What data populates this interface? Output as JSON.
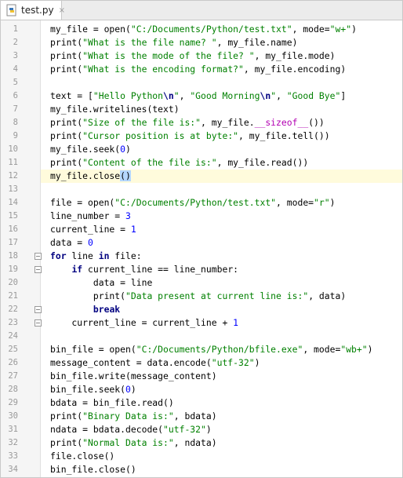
{
  "tab": {
    "label": "test.py",
    "close": "×"
  },
  "code": {
    "current_line": 12,
    "lines": [
      {
        "n": "1",
        "t": [
          [
            "my_file = open(",
            ""
          ],
          [
            "\"C:/Documents/Python/test.txt\"",
            "s"
          ],
          [
            ", mode=",
            ""
          ],
          [
            "\"w+\"",
            "s"
          ],
          [
            ")",
            ""
          ]
        ]
      },
      {
        "n": "2",
        "t": [
          [
            "print(",
            ""
          ],
          [
            "\"What is the file name? \"",
            "s"
          ],
          [
            ", my_file.name)",
            ""
          ]
        ]
      },
      {
        "n": "3",
        "t": [
          [
            "print(",
            ""
          ],
          [
            "\"What is the mode of the file? \"",
            "s"
          ],
          [
            ", my_file.mode)",
            ""
          ]
        ]
      },
      {
        "n": "4",
        "t": [
          [
            "print(",
            ""
          ],
          [
            "\"What is the encoding format?\"",
            "s"
          ],
          [
            ", my_file.encoding)",
            ""
          ]
        ]
      },
      {
        "n": "5",
        "t": []
      },
      {
        "n": "6",
        "t": [
          [
            "text = [",
            ""
          ],
          [
            "\"Hello Python",
            "s"
          ],
          [
            "\\n",
            "e"
          ],
          [
            "\"",
            "s"
          ],
          [
            ", ",
            ""
          ],
          [
            "\"Good Morning",
            "s"
          ],
          [
            "\\n",
            "e"
          ],
          [
            "\"",
            "s"
          ],
          [
            ", ",
            ""
          ],
          [
            "\"Good Bye\"",
            "s"
          ],
          [
            "]",
            ""
          ]
        ]
      },
      {
        "n": "7",
        "t": [
          [
            "my_file.writelines(text)",
            ""
          ]
        ]
      },
      {
        "n": "8",
        "t": [
          [
            "print(",
            ""
          ],
          [
            "\"Size of the file is:\"",
            "s"
          ],
          [
            ", my_file.",
            ""
          ],
          [
            "__sizeof__",
            "d"
          ],
          [
            "())",
            ""
          ]
        ]
      },
      {
        "n": "9",
        "t": [
          [
            "print(",
            ""
          ],
          [
            "\"Cursor position is at byte:\"",
            "s"
          ],
          [
            ", my_file.tell())",
            ""
          ]
        ]
      },
      {
        "n": "10",
        "t": [
          [
            "my_file.seek(",
            ""
          ],
          [
            "0",
            "n"
          ],
          [
            ")",
            ""
          ]
        ]
      },
      {
        "n": "11",
        "t": [
          [
            "print(",
            ""
          ],
          [
            "\"Content of the file is:\"",
            "s"
          ],
          [
            ", my_file.read())",
            ""
          ]
        ]
      },
      {
        "n": "12",
        "t": [
          [
            "my_file.close",
            ""
          ],
          [
            "()",
            "caret"
          ]
        ]
      },
      {
        "n": "13",
        "t": []
      },
      {
        "n": "14",
        "t": [
          [
            "file = open(",
            ""
          ],
          [
            "\"C:/Documents/Python/test.txt\"",
            "s"
          ],
          [
            ", mode=",
            ""
          ],
          [
            "\"r\"",
            "s"
          ],
          [
            ")",
            ""
          ]
        ]
      },
      {
        "n": "15",
        "t": [
          [
            "line_number = ",
            ""
          ],
          [
            "3",
            "n"
          ]
        ]
      },
      {
        "n": "16",
        "t": [
          [
            "current_line = ",
            ""
          ],
          [
            "1",
            "n"
          ]
        ]
      },
      {
        "n": "17",
        "t": [
          [
            "data = ",
            ""
          ],
          [
            "0",
            "n"
          ]
        ]
      },
      {
        "n": "18",
        "fold": true,
        "t": [
          [
            "for",
            "k"
          ],
          [
            " line ",
            ""
          ],
          [
            "in",
            "k"
          ],
          [
            " file:",
            ""
          ]
        ]
      },
      {
        "n": "19",
        "fold": true,
        "t": [
          [
            "    ",
            ""
          ],
          [
            "if",
            "k"
          ],
          [
            " current_line == line_number:",
            ""
          ]
        ]
      },
      {
        "n": "20",
        "t": [
          [
            "        data = line",
            ""
          ]
        ]
      },
      {
        "n": "21",
        "t": [
          [
            "        print(",
            ""
          ],
          [
            "\"Data present at current line is:\"",
            "s"
          ],
          [
            ", data)",
            ""
          ]
        ]
      },
      {
        "n": "22",
        "fold": true,
        "t": [
          [
            "        ",
            ""
          ],
          [
            "break",
            "k"
          ]
        ]
      },
      {
        "n": "23",
        "fold": true,
        "t": [
          [
            "    current_line = current_line + ",
            ""
          ],
          [
            "1",
            "n"
          ]
        ]
      },
      {
        "n": "24",
        "t": []
      },
      {
        "n": "25",
        "t": [
          [
            "bin_file = open(",
            ""
          ],
          [
            "\"C:/Documents/Python/bfile.exe\"",
            "s"
          ],
          [
            ", mode=",
            ""
          ],
          [
            "\"wb+\"",
            "s"
          ],
          [
            ")",
            ""
          ]
        ]
      },
      {
        "n": "26",
        "t": [
          [
            "message_content = data.encode(",
            ""
          ],
          [
            "\"utf-32\"",
            "s"
          ],
          [
            ")",
            ""
          ]
        ]
      },
      {
        "n": "27",
        "t": [
          [
            "bin_file.write(message_content)",
            ""
          ]
        ]
      },
      {
        "n": "28",
        "t": [
          [
            "bin_file.seek(",
            ""
          ],
          [
            "0",
            "n"
          ],
          [
            ")",
            ""
          ]
        ]
      },
      {
        "n": "29",
        "t": [
          [
            "bdata = bin_file.read()",
            ""
          ]
        ]
      },
      {
        "n": "30",
        "t": [
          [
            "print(",
            ""
          ],
          [
            "\"Binary Data is:\"",
            "s"
          ],
          [
            ", bdata)",
            ""
          ]
        ]
      },
      {
        "n": "31",
        "t": [
          [
            "ndata = bdata.decode(",
            ""
          ],
          [
            "\"utf-32\"",
            "s"
          ],
          [
            ")",
            ""
          ]
        ]
      },
      {
        "n": "32",
        "t": [
          [
            "print(",
            ""
          ],
          [
            "\"Normal Data is:\"",
            "s"
          ],
          [
            ", ndata)",
            ""
          ]
        ]
      },
      {
        "n": "33",
        "t": [
          [
            "file.close()",
            ""
          ]
        ]
      },
      {
        "n": "34",
        "t": [
          [
            "bin_file.close()",
            ""
          ]
        ]
      }
    ]
  }
}
